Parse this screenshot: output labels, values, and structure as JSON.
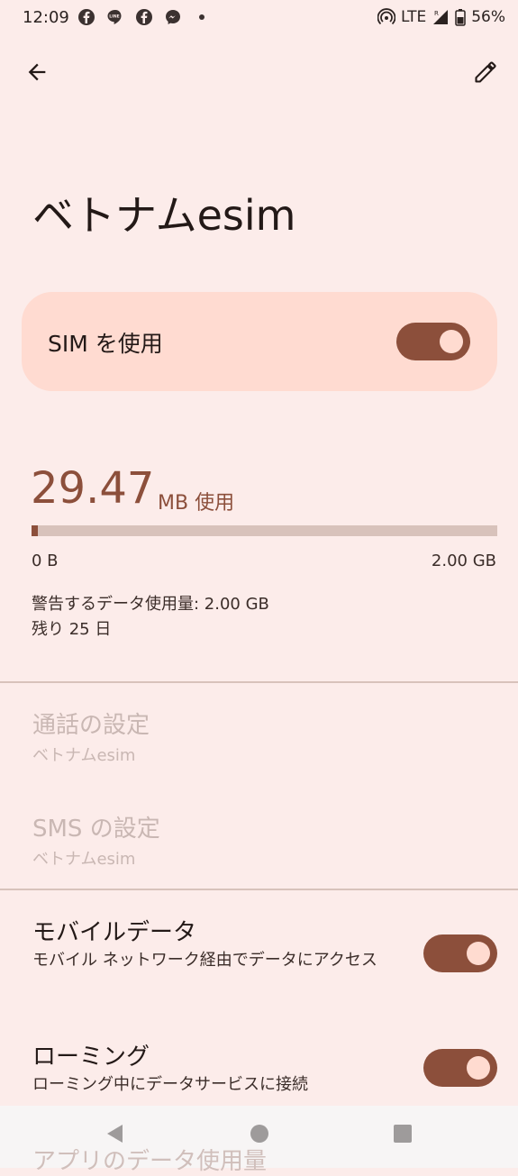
{
  "status_bar": {
    "time": "12:09",
    "network": "LTE",
    "battery": "56%",
    "notification_icons": [
      "facebook-icon",
      "line-icon",
      "facebook-icon",
      "messenger-icon",
      "dot-icon"
    ]
  },
  "toolbar": {
    "back_icon": "back-arrow-icon",
    "edit_icon": "pencil-icon"
  },
  "page": {
    "title": "ベトナムesim"
  },
  "sim_toggle": {
    "label": "SIM を使用",
    "enabled": true
  },
  "data_usage": {
    "value": "29.47",
    "unit_label": "MB 使用",
    "progress_fraction": 0.014,
    "min_label": "0 B",
    "max_label": "2.00 GB",
    "warning_text": "警告するデータ使用量: 2.00 GB",
    "remaining_text": "残り 25 日"
  },
  "settings": {
    "call": {
      "title": "通話の設定",
      "subtitle": "ベトナムesim"
    },
    "sms": {
      "title": "SMS の設定",
      "subtitle": "ベトナムesim"
    },
    "mobile_data": {
      "title": "モバイルデータ",
      "subtitle": "モバイル ネットワーク経由でデータにアクセス",
      "enabled": true
    },
    "roaming": {
      "title": "ローミング",
      "subtitle": "ローミング中にデータサービスに接続",
      "enabled": true
    },
    "app_data_usage": {
      "title": "アプリのデータ使用量"
    }
  },
  "colors": {
    "background": "#fcecea",
    "accent": "#8c4f3b",
    "sim_card": "#ffdbd1",
    "track": "#d8c2bb",
    "disabled_text": "#c9b7b3"
  }
}
